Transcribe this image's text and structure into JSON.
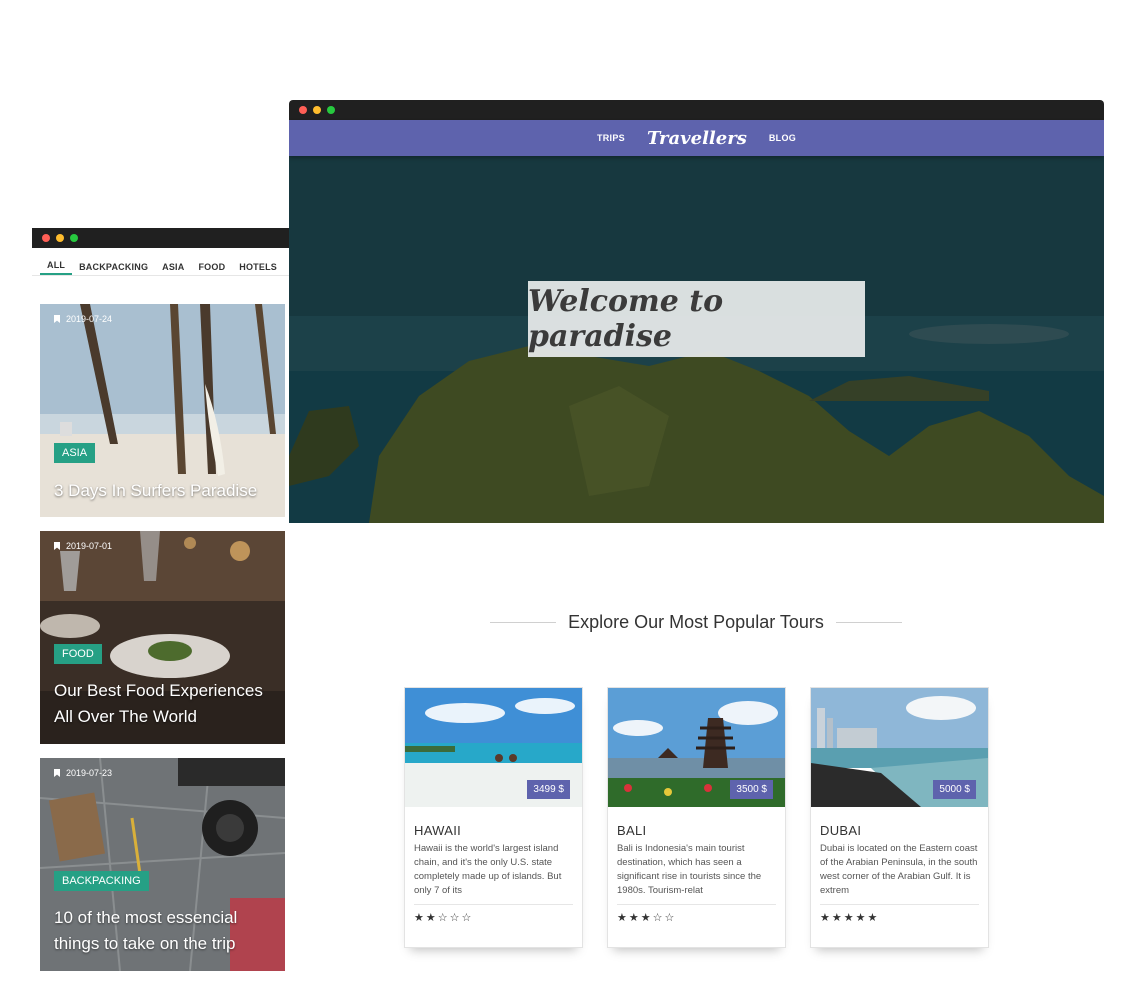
{
  "blog": {
    "tabs": [
      "ALL",
      "BACKPACKING",
      "ASIA",
      "FOOD",
      "HOTELS"
    ],
    "posts": [
      {
        "date": "2019-07-24",
        "tag": "ASIA",
        "title": "3 Days In Surfers Paradise"
      },
      {
        "date": "2019-07-01",
        "tag": "FOOD",
        "title": "Our Best Food Experiences All Over The World"
      },
      {
        "date": "2019-07-23",
        "tag": "BACKPACKING",
        "title": "10 of the most essencial things to take on the trip"
      }
    ]
  },
  "nav": {
    "trips": "TRIPS",
    "brand": "Travellers",
    "blog": "BLOG"
  },
  "hero": {
    "title": "Welcome to paradise"
  },
  "tours_section": {
    "heading": "Explore Our Most Popular Tours"
  },
  "tours": [
    {
      "name": "HAWAII",
      "price": "3499 $",
      "desc": "Hawaii is the world's largest island chain, and it's the only U.S. state completely made up of islands. But only 7 of its",
      "stars": "★★☆☆☆",
      "rating": 2
    },
    {
      "name": "BALI",
      "price": "3500 $",
      "desc": "Bali is Indonesia's main tourist destination, which has seen a significant rise in tourists since the 1980s. Tourism-relat",
      "stars": "★★★☆☆",
      "rating": 3
    },
    {
      "name": "DUBAI",
      "price": "5000 $",
      "desc": "Dubai is located on the Eastern coast of the Arabian Peninsula, in the south west corner of the Arabian Gulf. It is extrem",
      "stars": "★★★★★",
      "rating": 5
    }
  ],
  "colors": {
    "accent": "#5e63ad",
    "tag": "#26a085"
  }
}
